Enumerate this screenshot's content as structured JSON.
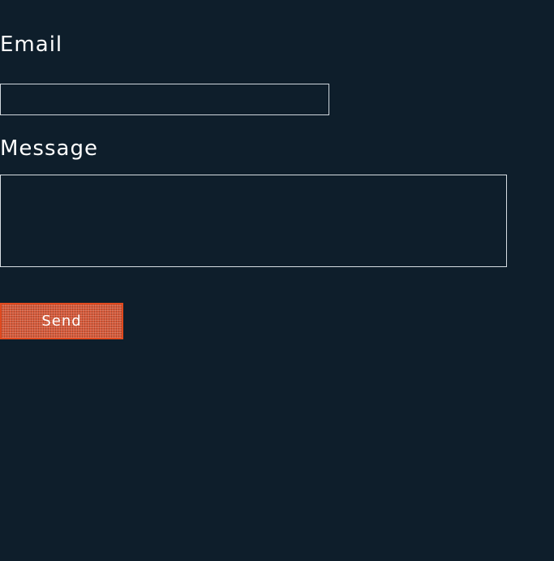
{
  "form": {
    "email_label": "Email",
    "email_value": "",
    "message_label": "Message",
    "message_value": "",
    "send_label": "Send"
  },
  "colors": {
    "background": "#0e1e2b",
    "text": "#ffffff",
    "accent": "#e04a1f"
  }
}
